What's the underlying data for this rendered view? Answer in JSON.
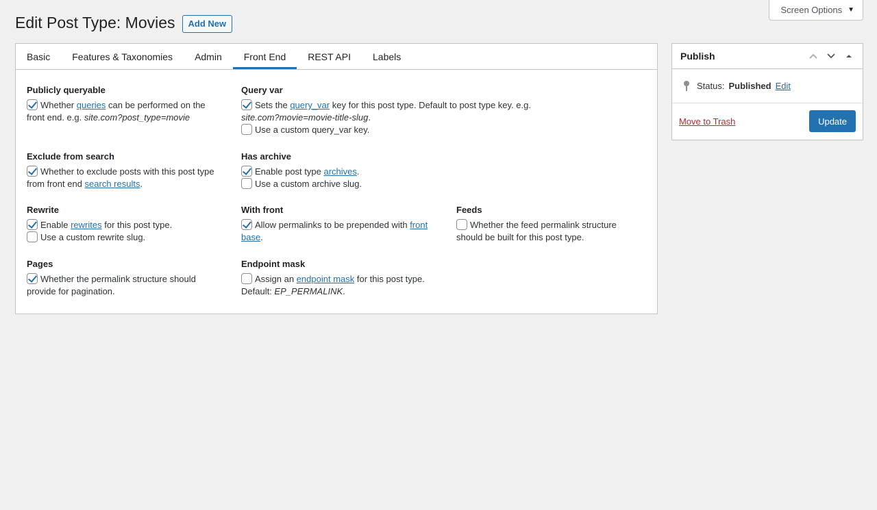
{
  "screen_options": {
    "label": "Screen Options",
    "caret": "▼"
  },
  "header": {
    "title": "Edit Post Type: Movies",
    "add_new": "Add New"
  },
  "tabs": [
    {
      "label": "Basic"
    },
    {
      "label": "Features & Taxonomies"
    },
    {
      "label": "Admin"
    },
    {
      "label": "Front End",
      "active": true
    },
    {
      "label": "REST API"
    },
    {
      "label": "Labels"
    }
  ],
  "fields": {
    "publicly_queryable": {
      "label": "Publicly queryable",
      "t1": "Whether ",
      "link": "queries",
      "t2": " can be performed on the front end. e.g. ",
      "example": "site.com?post_type=movie",
      "checked": true
    },
    "query_var": {
      "label": "Query var",
      "t1": "Sets the ",
      "link": "query_var",
      "t2": " key for this post type. Default to post type key. e.g. ",
      "example": "site.com?movie=movie-title-slug",
      "t3": ".",
      "checked": true,
      "custom": "Use a custom query_var key.",
      "custom_checked": false
    },
    "exclude_from_search": {
      "label": "Exclude from search",
      "t1": "Whether to exclude posts with this post type from front end ",
      "link": "search results",
      "t2": ".",
      "checked": true
    },
    "has_archive": {
      "label": "Has archive",
      "t1": "Enable post type ",
      "link": "archives",
      "t2": ".",
      "checked": true,
      "custom": "Use a custom archive slug.",
      "custom_checked": false
    },
    "rewrite": {
      "label": "Rewrite",
      "t1": "Enable ",
      "link": "rewrites",
      "t2": " for this post type.",
      "checked": true,
      "custom": "Use a custom rewrite slug.",
      "custom_checked": false
    },
    "with_front": {
      "label": "With front",
      "t1": "Allow permalinks to be prepended with ",
      "link": "front base",
      "t2": ".",
      "checked": true
    },
    "feeds": {
      "label": "Feeds",
      "t1": "Whether the feed permalink structure should be built for this post type.",
      "checked": false
    },
    "pages": {
      "label": "Pages",
      "t1": "Whether the permalink structure should provide for pagination.",
      "checked": true
    },
    "endpoint_mask": {
      "label": "Endpoint mask",
      "t1": "Assign an ",
      "link": "endpoint mask",
      "t2": " for this post type. Default: ",
      "example": "EP_PERMALINK",
      "t3": ".",
      "checked": false
    }
  },
  "publish": {
    "title": "Publish",
    "status_label": "Status:",
    "status_value": "Published",
    "edit": "Edit",
    "trash": "Move to Trash",
    "update": "Update"
  },
  "colors": {
    "accent": "#2271b1",
    "danger": "#b32d2e",
    "background": "#f0f0f1"
  }
}
